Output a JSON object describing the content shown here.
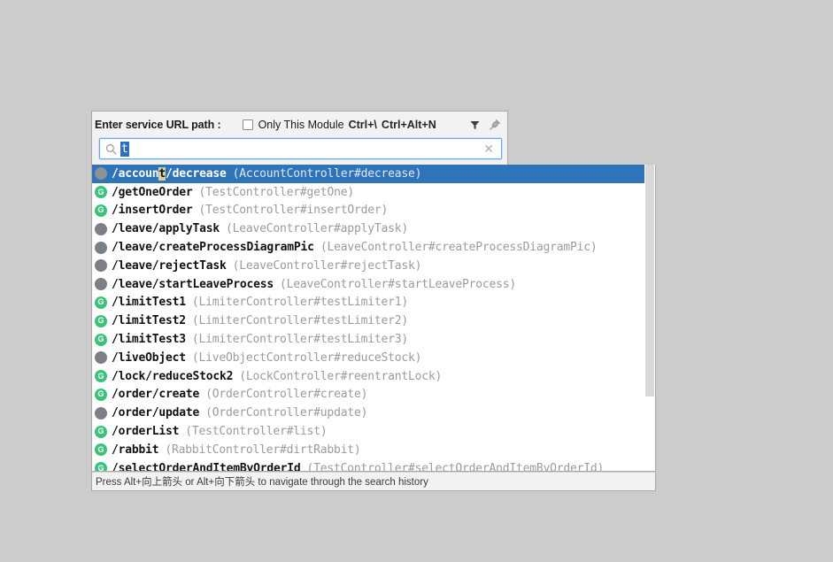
{
  "dialog": {
    "title": "Enter service URL path :",
    "module_filter": {
      "label": "Only This Module",
      "shortcut_1": "Ctrl+\\",
      "shortcut_2": "Ctrl+Alt+N",
      "checked": false
    },
    "icons": {
      "filter": "filter-icon",
      "pin": "pin-icon"
    },
    "search": {
      "value": "t",
      "placeholder": "",
      "search_icon": "search-icon",
      "clear_icon": "clear-icon"
    },
    "footer_hint": "Press Alt+向上箭头 or Alt+向下箭头 to navigate through the search history"
  },
  "colors": {
    "selection": "#2f74b9",
    "get_badge": "#3cc27a",
    "post_badge": "#7a8085",
    "match_highlight": "#d6cfa0",
    "page_background": "#cccccc"
  },
  "results": [
    {
      "method": "POST",
      "badge": "",
      "path_before": "/accoun",
      "path_match": "t",
      "path_after": "/decrease",
      "handler": "(AccountController#decrease)",
      "selected": true
    },
    {
      "method": "GET",
      "badge": "G",
      "path_before": "/getOneOrder",
      "path_match": "",
      "path_after": "",
      "handler": "(TestController#getOne)",
      "selected": false
    },
    {
      "method": "GET",
      "badge": "G",
      "path_before": "/insertOrder",
      "path_match": "",
      "path_after": "",
      "handler": "(TestController#insertOrder)",
      "selected": false
    },
    {
      "method": "POST",
      "badge": "",
      "path_before": "/leave/applyTask",
      "path_match": "",
      "path_after": "",
      "handler": "(LeaveController#applyTask)",
      "selected": false
    },
    {
      "method": "POST",
      "badge": "",
      "path_before": "/leave/createProcessDiagramPic",
      "path_match": "",
      "path_after": "",
      "handler": "(LeaveController#createProcessDiagramPic)",
      "selected": false
    },
    {
      "method": "POST",
      "badge": "",
      "path_before": "/leave/rejectTask",
      "path_match": "",
      "path_after": "",
      "handler": "(LeaveController#rejectTask)",
      "selected": false
    },
    {
      "method": "POST",
      "badge": "",
      "path_before": "/leave/startLeaveProcess",
      "path_match": "",
      "path_after": "",
      "handler": "(LeaveController#startLeaveProcess)",
      "selected": false
    },
    {
      "method": "GET",
      "badge": "G",
      "path_before": "/limitTest1",
      "path_match": "",
      "path_after": "",
      "handler": "(LimiterController#testLimiter1)",
      "selected": false
    },
    {
      "method": "GET",
      "badge": "G",
      "path_before": "/limitTest2",
      "path_match": "",
      "path_after": "",
      "handler": "(LimiterController#testLimiter2)",
      "selected": false
    },
    {
      "method": "GET",
      "badge": "G",
      "path_before": "/limitTest3",
      "path_match": "",
      "path_after": "",
      "handler": "(LimiterController#testLimiter3)",
      "selected": false
    },
    {
      "method": "POST",
      "badge": "",
      "path_before": "/liveObject",
      "path_match": "",
      "path_after": "",
      "handler": "(LiveObjectController#reduceStock)",
      "selected": false
    },
    {
      "method": "GET",
      "badge": "G",
      "path_before": "/lock/reduceStock2",
      "path_match": "",
      "path_after": "",
      "handler": "(LockController#reentrantLock)",
      "selected": false
    },
    {
      "method": "GET",
      "badge": "G",
      "path_before": "/order/create",
      "path_match": "",
      "path_after": "",
      "handler": "(OrderController#create)",
      "selected": false
    },
    {
      "method": "POST",
      "badge": "",
      "path_before": "/order/update",
      "path_match": "",
      "path_after": "",
      "handler": "(OrderController#update)",
      "selected": false
    },
    {
      "method": "GET",
      "badge": "G",
      "path_before": "/orderList",
      "path_match": "",
      "path_after": "",
      "handler": "(TestController#list)",
      "selected": false
    },
    {
      "method": "GET",
      "badge": "G",
      "path_before": "/rabbit",
      "path_match": "",
      "path_after": "",
      "handler": "(RabbitController#dirtRabbit)",
      "selected": false
    },
    {
      "method": "GET",
      "badge": "G",
      "path_before": "/selectOrderAndItemByOrderId",
      "path_match": "",
      "path_after": "",
      "handler": "(TestController#selectOrderAndItemByOrderId)",
      "selected": false
    }
  ]
}
